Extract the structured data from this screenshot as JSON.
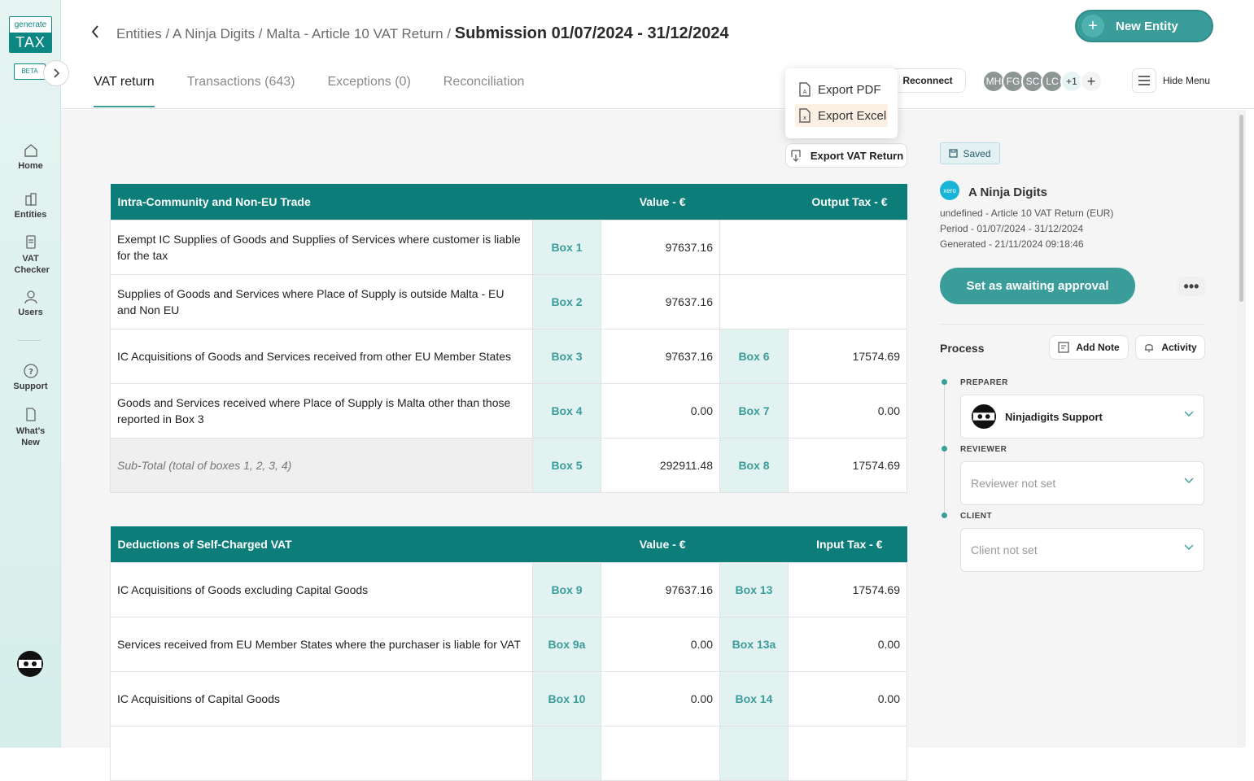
{
  "sidebar": {
    "logo_top": "generate",
    "logo_bottom": "TAX",
    "beta": "BETA",
    "items": [
      {
        "label": "Home"
      },
      {
        "label": "Entities"
      },
      {
        "label": "VAT Checker"
      },
      {
        "label": "Users"
      },
      {
        "label": "Support"
      },
      {
        "label": "What's New"
      }
    ]
  },
  "header": {
    "breadcrumb": "Entities / A Ninja Digits / Malta - Article 10 VAT Return /",
    "title": "Submission 01/07/2024 - 31/12/2024",
    "new_entity": "New Entity",
    "tabs": [
      "VAT return",
      "Transactions (643)",
      "Exceptions (0)",
      "Reconciliation"
    ],
    "reconnect": "Reconnect",
    "users": [
      "MH",
      "FG",
      "SC",
      "LC",
      "+1"
    ],
    "add_user": "+",
    "hide_menu": "Hide Menu"
  },
  "export_menu": {
    "items": [
      "Export PDF",
      "Export Excel"
    ]
  },
  "export_vat": "Export VAT Return",
  "trade_table": {
    "headers": [
      "Intra-Community and Non-EU Trade",
      "Value - €",
      "Output Tax - €"
    ],
    "rows": [
      {
        "desc": "Exempt IC Supplies of Goods and Supplies of Services where customer is liable for the tax",
        "box": "Box 1",
        "value": "97637.16"
      },
      {
        "desc": "Supplies of Goods and Services where Place of Supply is outside Malta - EU and Non EU",
        "box": "Box 2",
        "value": "97637.16"
      },
      {
        "desc": "IC Acquisitions of Goods and Services received from other EU Member States",
        "box": "Box 3",
        "value": "97637.16",
        "box2": "Box 6",
        "value2": "17574.69"
      },
      {
        "desc": "Goods and Services received where Place of Supply is Malta other than those reported in Box 3",
        "box": "Box 4",
        "value": "0.00",
        "box2": "Box 7",
        "value2": "0.00"
      },
      {
        "desc": "Sub-Total (total of boxes 1, 2, 3, 4)",
        "box": "Box 5",
        "value": "292911.48",
        "box2": "Box 8",
        "value2": "17574.69"
      }
    ]
  },
  "deductions_table": {
    "headers": [
      "Deductions of Self-Charged VAT",
      "Value - €",
      "Input Tax - €"
    ],
    "rows": [
      {
        "desc": "IC Acquisitions of Goods excluding Capital Goods",
        "box": "Box 9",
        "value": "97637.16",
        "box2": "Box 13",
        "value2": "17574.69"
      },
      {
        "desc": "Services received from EU Member States where the purchaser is liable for VAT",
        "box": "Box 9a",
        "value": "0.00",
        "box2": "Box 13a",
        "value2": "0.00"
      },
      {
        "desc": "IC Acquisitions of Capital Goods",
        "box": "Box 10",
        "value": "0.00",
        "box2": "Box 14",
        "value2": "0.00"
      }
    ]
  },
  "right_panel": {
    "saved": "Saved",
    "entity_badge": "xero",
    "entity_name": "A Ninja Digits",
    "lines": [
      "undefined - Article 10 VAT Return (EUR)",
      "Period - 01/07/2024 - 31/12/2024",
      "Generated - 21/11/2024 09:18:46"
    ],
    "approve": "Set as awaiting approval",
    "more": "•••",
    "process": "Process",
    "add_note": "Add Note",
    "activity": "Activity",
    "preparer_label": "PREPARER",
    "preparer_value": "Ninjadigits Support",
    "reviewer_label": "REVIEWER",
    "reviewer_placeholder": "Reviewer not set",
    "client_label": "CLIENT",
    "client_placeholder": "Client not set"
  },
  "colors": {
    "accent": "#3a9d9a",
    "table_header": "#0d7d7a",
    "box_bg": "#e2f2f1"
  }
}
